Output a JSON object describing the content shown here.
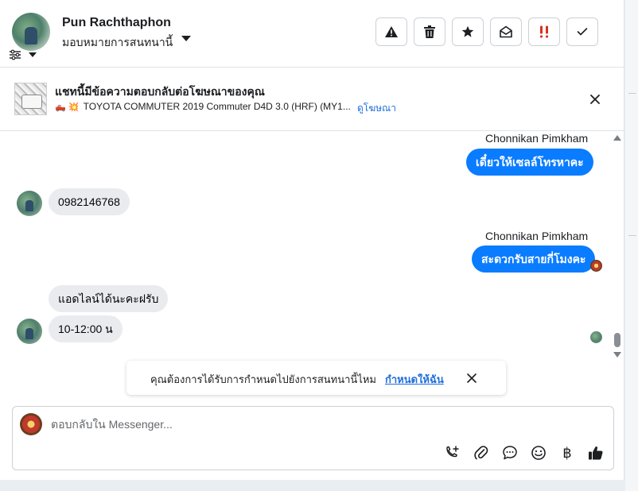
{
  "header": {
    "contact_name": "Pun Rachthaphon",
    "assign_label": "มอบหมายการสนทนานี้",
    "avatar_icon": "profile-avatar",
    "filter_icon": "filter-sliders-icon",
    "toolbar": [
      {
        "name": "spam-button",
        "icon": "warning-triangle-icon"
      },
      {
        "name": "delete-button",
        "icon": "trash-icon"
      },
      {
        "name": "star-button",
        "icon": "star-icon"
      },
      {
        "name": "mark-unread-button",
        "icon": "envelope-open-icon"
      },
      {
        "name": "follow-up-button",
        "icon": "double-exclamation-icon",
        "color": "#d93025"
      },
      {
        "name": "done-button",
        "icon": "check-icon"
      }
    ]
  },
  "ad_banner": {
    "title": "แชทนี้มีข้อความตอบกลับต่อโฆษณาของคุณ",
    "subtitle_emoji": "🛻 💥",
    "subtitle": "TOYOTA COMMUTER 2019 Commuter D4D 3.0 (HRF) (MY1...",
    "link": "ดูโฆษณา",
    "close_icon": "close-icon"
  },
  "messages": [
    {
      "direction": "out",
      "sender": "Chonnikan Pimkham",
      "text": "เดี๋ยวให้เซลล์โทรหาคะ"
    },
    {
      "direction": "in",
      "text": "0982146768"
    },
    {
      "direction": "out",
      "sender": "Chonnikan Pimkham",
      "text": "สะดวกรับสายกี่โมงคะ"
    },
    {
      "direction": "in",
      "text": "แอดไลน์ได้นะคะฝรับ"
    },
    {
      "direction": "in",
      "text": "10-12:00 น"
    }
  ],
  "assign_toast": {
    "text": "คุณต้องการได้รับการกำหนดไปยังการสนทนานี้ไหม",
    "link": "กำหนดให้ฉัน",
    "close_icon": "close-icon"
  },
  "composer": {
    "placeholder": "ตอบกลับใน Messenger...",
    "value": "",
    "icons": [
      "phone-plus-icon",
      "paperclip-icon",
      "speech-bubble-icon",
      "emoji-icon",
      "baht-icon",
      "thumbs-up-icon"
    ],
    "baht_symbol": "฿"
  },
  "colors": {
    "outgoing_bubble": "#0a7cff",
    "incoming_bubble": "#e9ebee",
    "link": "#216fdb",
    "alert_red": "#d93025"
  }
}
